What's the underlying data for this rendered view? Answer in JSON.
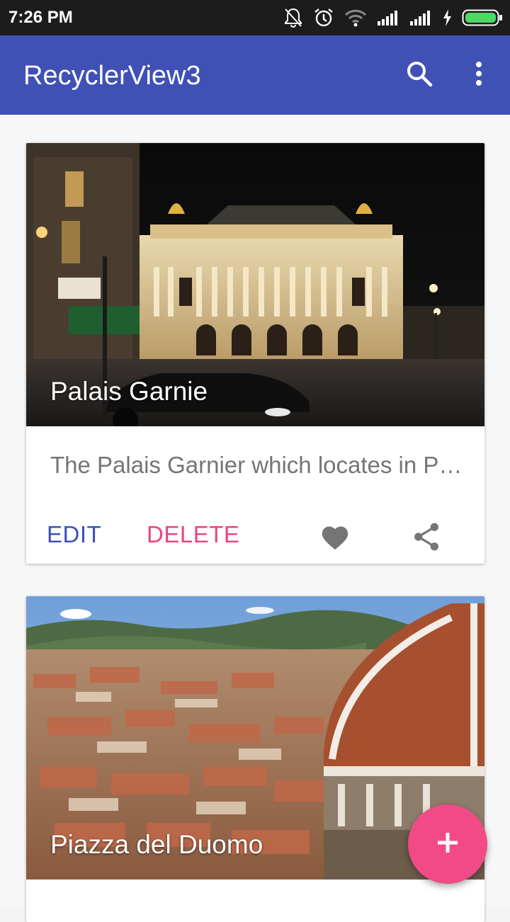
{
  "status_bar": {
    "time": "7:26 PM",
    "icons": [
      "notifications-off-icon",
      "alarm-icon",
      "wifi-icon",
      "signal-icon",
      "signal-icon",
      "charging-icon",
      "battery-icon"
    ],
    "battery_color": "#4cd964"
  },
  "app_bar": {
    "title": "RecyclerView3",
    "background": "#3f51b5",
    "actions": [
      "search-icon",
      "more-vert-icon"
    ]
  },
  "cards": [
    {
      "title": "Palais Garnie",
      "description": "The Palais Garnier which locates in Paris, France",
      "actions": {
        "edit": "EDIT",
        "delete": "DELETE"
      },
      "icons": [
        "favorite-icon",
        "share-icon"
      ],
      "image": "palais-garnier-night-photo"
    },
    {
      "title": "Piazza del Duomo",
      "image": "florence-duomo-photo"
    }
  ],
  "colors": {
    "primary": "#3f51b5",
    "accent": "#f24a87"
  },
  "fab": {
    "icon": "add-icon"
  }
}
